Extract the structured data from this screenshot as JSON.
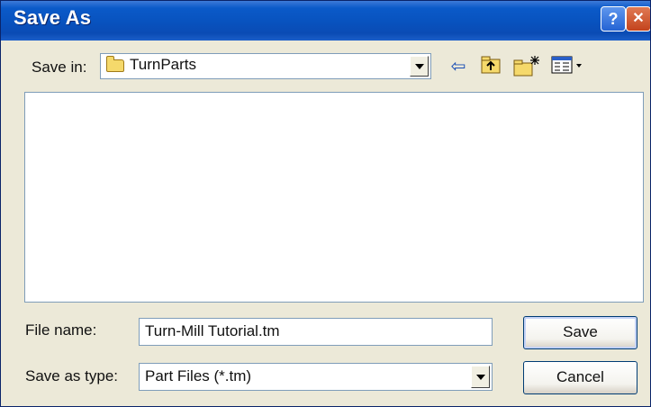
{
  "window": {
    "title": "Save As",
    "help_glyph": "?",
    "close_glyph": "✕"
  },
  "save_in": {
    "label": "Save in:",
    "folder": "TurnParts",
    "folder_icon": "folder-icon"
  },
  "toolbar": {
    "back_icon": "⇦",
    "up_folder_icon": "⬆",
    "new_folder_icon": "✳",
    "views_icon": "▦▾"
  },
  "file_name": {
    "label": "File name:",
    "value": "Turn-Mill Tutorial.tm"
  },
  "save_as_type": {
    "label": "Save as type:",
    "value": "Part Files (*.tm)"
  },
  "buttons": {
    "save": "Save",
    "cancel": "Cancel"
  }
}
